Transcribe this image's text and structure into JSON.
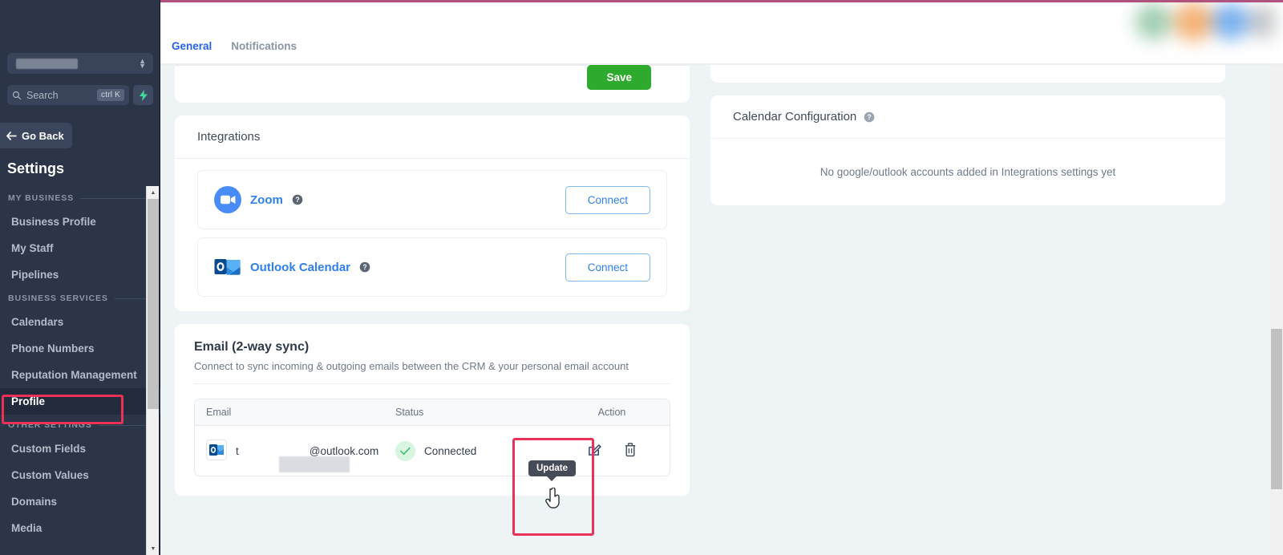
{
  "theme": {
    "accent_top_line": "#b0537f",
    "sidebar_bg": "#2b3547",
    "page_bg": "#eef3f6",
    "link_blue": "#2f80ed",
    "save_green": "#2eaa2e",
    "highlight_red": "#ec3158",
    "status_green_bg": "#d8f5e0"
  },
  "sidebar": {
    "location_select": {
      "value": "",
      "redacted": true
    },
    "search": {
      "placeholder": "Search",
      "shortcut": "ctrl K",
      "icon": "search-icon"
    },
    "quick_action_icon": "lightning-bolt-icon",
    "go_back_label": "Go Back",
    "title": "Settings",
    "groups": [
      {
        "label": "MY BUSINESS",
        "items": [
          {
            "label": "Business Profile",
            "active": false
          },
          {
            "label": "My Staff",
            "active": false
          },
          {
            "label": "Pipelines",
            "active": false
          }
        ]
      },
      {
        "label": "BUSINESS SERVICES",
        "items": [
          {
            "label": "Calendars",
            "active": false
          },
          {
            "label": "Phone Numbers",
            "active": false
          },
          {
            "label": "Reputation Management",
            "active": false
          },
          {
            "label": "Profile",
            "active": true
          }
        ]
      },
      {
        "label": "OTHER SETTINGS",
        "items": [
          {
            "label": "Custom Fields",
            "active": false
          },
          {
            "label": "Custom Values",
            "active": false
          },
          {
            "label": "Domains",
            "active": false
          },
          {
            "label": "Media",
            "active": false
          }
        ]
      }
    ]
  },
  "topbar": {
    "tabs": [
      {
        "label": "General",
        "active": true
      },
      {
        "label": "Notifications",
        "active": false
      }
    ]
  },
  "main": {
    "save_button": "Save",
    "integrations": {
      "title": "Integrations",
      "rows": [
        {
          "name": "Zoom",
          "icon": "zoom-video-icon",
          "help_icon": "help-circle-icon",
          "action": "Connect"
        },
        {
          "name": "Outlook Calendar",
          "icon": "outlook-icon",
          "help_icon": "help-circle-icon",
          "action": "Connect"
        }
      ]
    },
    "email_sync": {
      "title": "Email (2-way sync)",
      "subtitle": "Connect to sync incoming & outgoing emails between the CRM & your personal email account",
      "columns": [
        "Email",
        "Status",
        "Action"
      ],
      "rows": [
        {
          "email_prefix": "t",
          "email_suffix": "@outlook.com",
          "email_redacted": true,
          "icon": "outlook-icon",
          "status": "Connected",
          "status_icon": "check-icon",
          "actions": [
            "edit-icon",
            "delete-icon"
          ]
        }
      ],
      "tooltip": "Update"
    }
  },
  "right_panel": {
    "calendar_configuration": {
      "title": "Calendar Configuration",
      "help_icon": "help-circle-icon",
      "empty_message": "No google/outlook accounts added in Integrations settings yet"
    }
  }
}
